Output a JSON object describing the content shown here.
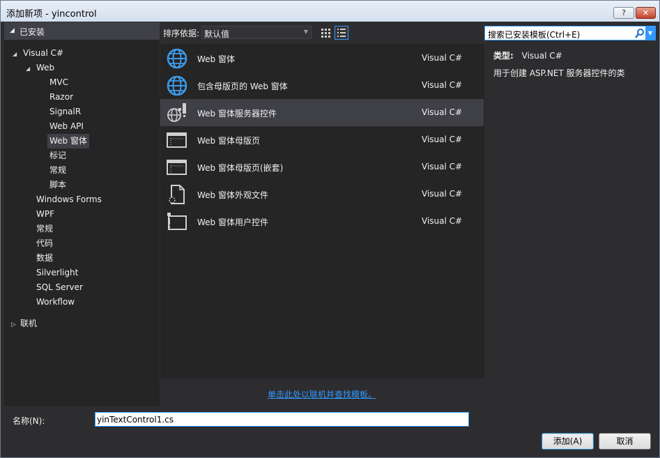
{
  "window": {
    "title": "添加新项 - yincontrol",
    "help_label": "?",
    "close_label": "✕"
  },
  "installed": {
    "header": "已安装",
    "tree": [
      {
        "label": "Visual C#",
        "level": 0,
        "expanded": true
      },
      {
        "label": "Web",
        "level": 1,
        "expanded": true
      },
      {
        "label": "MVC",
        "level": 2
      },
      {
        "label": "Razor",
        "level": 2
      },
      {
        "label": "SignalR",
        "level": 2
      },
      {
        "label": "Web API",
        "level": 2
      },
      {
        "label": "Web 窗体",
        "level": 2,
        "selected": true
      },
      {
        "label": "标记",
        "level": 2
      },
      {
        "label": "常规",
        "level": 2
      },
      {
        "label": "脚本",
        "level": 2
      },
      {
        "label": "Windows Forms",
        "level": 1
      },
      {
        "label": "WPF",
        "level": 1
      },
      {
        "label": "常规",
        "level": 1
      },
      {
        "label": "代码",
        "level": 1
      },
      {
        "label": "数据",
        "level": 1
      },
      {
        "label": "Silverlight",
        "level": 1
      },
      {
        "label": "SQL Server",
        "level": 1
      },
      {
        "label": "Workflow",
        "level": 1
      }
    ],
    "online": "联机"
  },
  "toolbar": {
    "sort_label": "排序依据:",
    "sort_value": "默认值"
  },
  "search": {
    "placeholder": "搜索已安装模板(Ctrl+E)"
  },
  "templates": [
    {
      "name": "Web 窗体",
      "lang": "Visual C#",
      "icon": "globe-icon"
    },
    {
      "name": "包含母版页的 Web 窗体",
      "lang": "Visual C#",
      "icon": "globe-icon"
    },
    {
      "name": "Web 窗体服务器控件",
      "lang": "Visual C#",
      "icon": "server-control-icon",
      "selected": true
    },
    {
      "name": "Web 窗体母版页",
      "lang": "Visual C#",
      "icon": "master-page-icon"
    },
    {
      "name": "Web 窗体母版页(嵌套)",
      "lang": "Visual C#",
      "icon": "master-page-icon"
    },
    {
      "name": "Web 窗体外观文件",
      "lang": "Visual C#",
      "icon": "skin-file-icon"
    },
    {
      "name": "Web 窗体用户控件",
      "lang": "Visual C#",
      "icon": "user-control-icon"
    }
  ],
  "detail": {
    "type_label": "类型:",
    "type_value": "Visual C#",
    "description": "用于创建 ASP.NET 服务器控件的类"
  },
  "online_link": "单击此处以联机并查找模板。",
  "name_field": {
    "label": "名称(N):",
    "value": "yinTextControl1.cs"
  },
  "buttons": {
    "add": "添加(A)",
    "cancel": "取消"
  },
  "colors": {
    "accent": "#3399ff",
    "background": "#2d2d30",
    "panel": "#252526",
    "selection": "#3f3f46"
  }
}
